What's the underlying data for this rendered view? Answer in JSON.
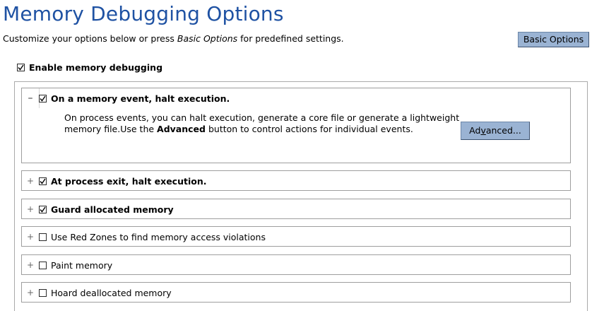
{
  "header": {
    "title": "Memory Debugging Options",
    "subtitle_pre": "Customize your options below or press ",
    "subtitle_em": "Basic Options",
    "subtitle_post": " for predefined settings.",
    "basic_button_label": "Basic Options"
  },
  "enable": {
    "label": "Enable memory debugging",
    "checked": true
  },
  "panels": [
    {
      "label": "On a memory event, halt execution.",
      "checked": true,
      "expanded": true,
      "bold": true,
      "description_pre": "On process events, you can halt execution, generate a core file or generate a lightweight memory file.Use the ",
      "description_bold": "Advanced",
      "description_post": " button to control actions for individual events.",
      "advanced_button_pre": "Ad",
      "advanced_button_underline": "v",
      "advanced_button_post": "anced..."
    },
    {
      "label": "At process exit, halt execution.",
      "checked": true,
      "expanded": false,
      "bold": true
    },
    {
      "label": "Guard allocated memory",
      "checked": true,
      "expanded": false,
      "bold": true
    },
    {
      "label": "Use Red Zones to find memory access violations",
      "checked": false,
      "expanded": false,
      "bold": false
    },
    {
      "label": "Paint memory",
      "checked": false,
      "expanded": false,
      "bold": false
    },
    {
      "label": "Hoard deallocated memory",
      "checked": false,
      "expanded": false,
      "bold": false
    }
  ],
  "icons": {
    "expand": "+",
    "collapse": "–"
  }
}
